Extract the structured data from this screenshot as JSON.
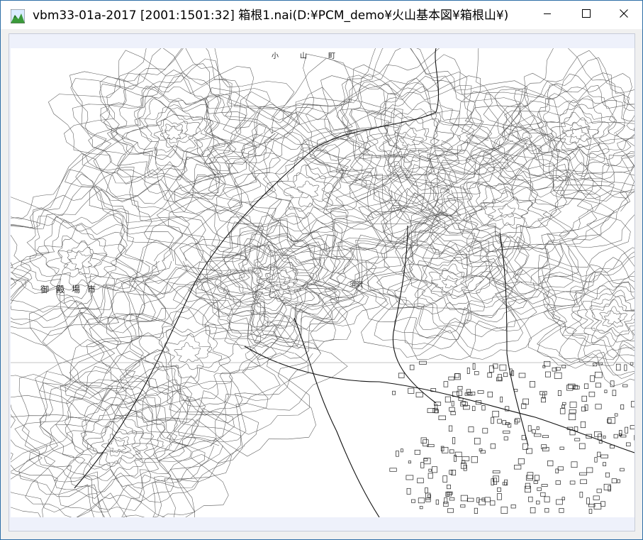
{
  "window": {
    "title": "vbm33-01a-2017 [2001:1501:32] 箱根1.nai(D:¥PCM_demo¥火山基本図¥箱根山¥)",
    "icon": "map-app-icon",
    "controls": {
      "minimize_icon": "minimize-icon",
      "maximize_icon": "maximize-icon",
      "close_icon": "close-icon"
    }
  },
  "map": {
    "labels": {
      "city": "御殿場市",
      "oyama": "小山町",
      "river": "須沢"
    }
  }
}
